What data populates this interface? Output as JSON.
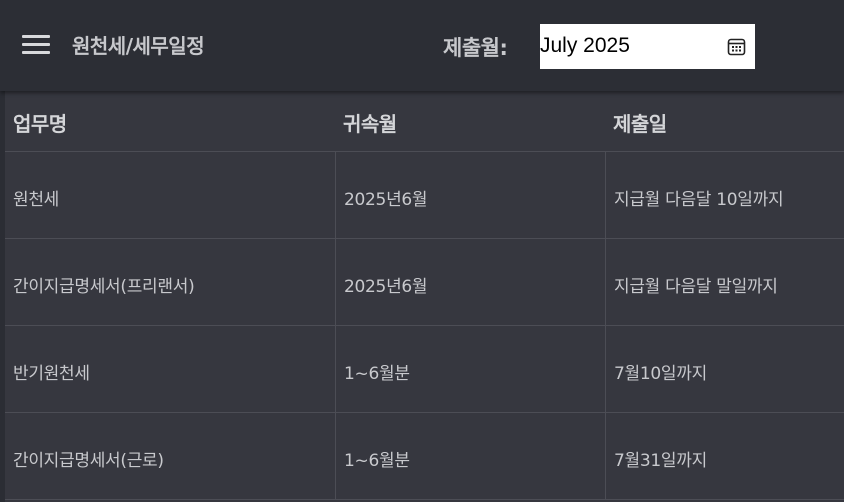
{
  "appbar": {
    "title": "원천세/세무일정",
    "month_label": "제출월:",
    "month_value": "July 2025",
    "menu_icon": "hamburger-menu-icon",
    "calendar_icon": "calendar-icon"
  },
  "table": {
    "headers": [
      "업무명",
      "귀속월",
      "제출일"
    ],
    "rows": [
      [
        "원천세",
        "2025년6월",
        "지급월 다음달 10일까지"
      ],
      [
        "간이지급명세서(프리랜서)",
        "2025년6월",
        "지급월 다음달 말일까지"
      ],
      [
        "반기원천세",
        "1~6월분",
        "7월10일까지"
      ],
      [
        "간이지급명세서(근로)",
        "1~6월분",
        "7월31일까지"
      ]
    ]
  },
  "colors": {
    "appbar_bg": "#2c2e35",
    "table_bg": "#36373f",
    "divider": "#4c4d55",
    "text": "#c8c9cd",
    "input_bg": "#ffffff"
  }
}
